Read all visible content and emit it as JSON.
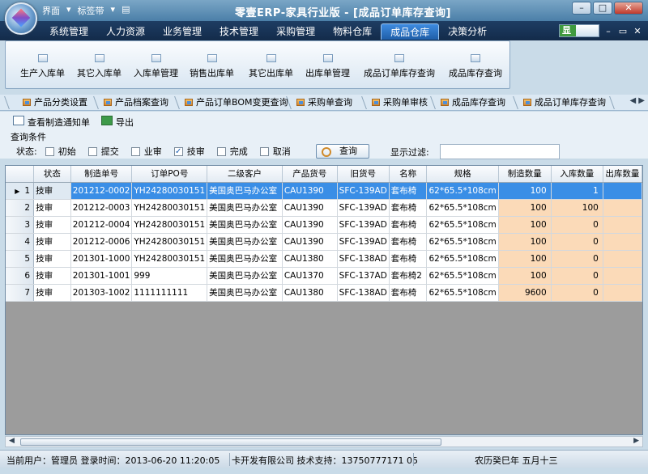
{
  "window": {
    "title": "零壹ERP-家具行业版 - [成品订单库存查询]",
    "quick_access": [
      "界面",
      "▾",
      "标签带",
      "▾"
    ]
  },
  "menu": {
    "items": [
      "系统管理",
      "人力资源",
      "业务管理",
      "技术管理",
      "采购管理",
      "物料仓库",
      "成品仓库",
      "决策分析"
    ],
    "active_index": 6,
    "skin_label": "显"
  },
  "ribbon": {
    "buttons": [
      "生产入库单",
      "其它入库单",
      "入库单管理",
      "销售出库单",
      "其它出库单",
      "出库单管理",
      "成品订单库存查询",
      "成品库存查询"
    ]
  },
  "tabs": {
    "items": [
      "产品分类设置",
      "产品档案查询",
      "产品订单BOM变更查询",
      "采购单查询",
      "采购单审核",
      "成品库存查询",
      "成品订单库存查询"
    ]
  },
  "toolbar": {
    "view_notice": "查看制造通知单",
    "export": "导出"
  },
  "query": {
    "section_label": "查询条件",
    "status_label": "状态:",
    "options": [
      {
        "label": "初始",
        "checked": false
      },
      {
        "label": "提交",
        "checked": false
      },
      {
        "label": "业审",
        "checked": false
      },
      {
        "label": "技审",
        "checked": true
      },
      {
        "label": "完成",
        "checked": false
      },
      {
        "label": "取消",
        "checked": false
      }
    ],
    "search_button": "查询",
    "filter_label": "显示过滤:",
    "filter_value": ""
  },
  "grid": {
    "columns": [
      "状态",
      "制造单号",
      "订单PO号",
      "二级客户",
      "产品货号",
      "旧货号",
      "名称",
      "规格",
      "制造数量",
      "入库数量",
      "出库数量"
    ],
    "selected_row": 0,
    "rows": [
      {
        "n": "1",
        "cells": [
          "技审",
          "201212-0002",
          "YH24280030151",
          "美国奥巴马办公室",
          "CAU1390",
          "SFC-139AD",
          "套布椅",
          "62*65.5*108cm",
          "100",
          "1",
          ""
        ]
      },
      {
        "n": "2",
        "cells": [
          "技审",
          "201212-0003",
          "YH24280030151",
          "美国奥巴马办公室",
          "CAU1390",
          "SFC-139AD",
          "套布椅",
          "62*65.5*108cm",
          "100",
          "100",
          ""
        ]
      },
      {
        "n": "3",
        "cells": [
          "技审",
          "201212-0004",
          "YH24280030151",
          "美国奥巴马办公室",
          "CAU1390",
          "SFC-139AD",
          "套布椅",
          "62*65.5*108cm",
          "100",
          "0",
          ""
        ]
      },
      {
        "n": "4",
        "cells": [
          "技审",
          "201212-0006",
          "YH24280030151",
          "美国奥巴马办公室",
          "CAU1390",
          "SFC-139AD",
          "套布椅",
          "62*65.5*108cm",
          "100",
          "0",
          ""
        ]
      },
      {
        "n": "5",
        "cells": [
          "技审",
          "201301-1000",
          "YH24280030151",
          "美国奥巴马办公室",
          "CAU1380",
          "SFC-138AD",
          "套布椅",
          "62*65.5*108cm",
          "100",
          "0",
          ""
        ]
      },
      {
        "n": "6",
        "cells": [
          "技审",
          "201301-1001",
          "999",
          "美国奥巴马办公室",
          "CAU1370",
          "SFC-137AD",
          "套布椅2",
          "62*65.5*108cm",
          "100",
          "0",
          ""
        ]
      },
      {
        "n": "7",
        "cells": [
          "技审",
          "201303-1002",
          "1111111111",
          "美国奥巴马办公室",
          "CAU1380",
          "SFC-138AD",
          "套布椅",
          "62*65.5*108cm",
          "9600",
          "0",
          ""
        ]
      }
    ]
  },
  "status": {
    "user": "当前用户：管理员 登录时间：2013-06-20 11:20:05",
    "company": "卡开发有限公司 技术支持：13750777171 05",
    "lunar": "农历癸巳年 五月十三"
  }
}
